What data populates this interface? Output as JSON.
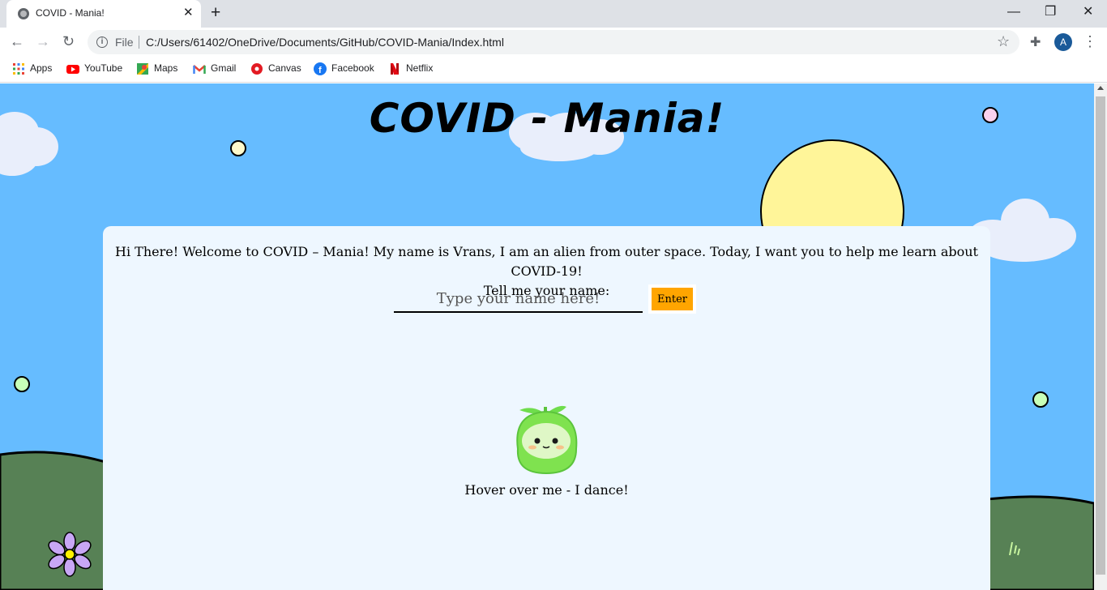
{
  "browser": {
    "tab_title": "COVID - Mania!",
    "tab_close": "✕",
    "new_tab": "+",
    "window_controls": {
      "minimize": "—",
      "restore": "❐",
      "close": "✕"
    },
    "nav": {
      "back": "←",
      "forward": "→",
      "reload": "↻"
    },
    "address": {
      "info": "i",
      "scheme_label": "File",
      "url": "C:/Users/61402/OneDrive/Documents/GitHub/COVID-Mania/Index.html"
    },
    "profile_initial": "A",
    "star": "☆",
    "extensions": "✚",
    "menu": "⋮",
    "bookmarks": [
      {
        "label": "Apps",
        "icon": "apps-grid-icon"
      },
      {
        "label": "YouTube",
        "icon": "youtube-icon"
      },
      {
        "label": "Maps",
        "icon": "maps-icon"
      },
      {
        "label": "Gmail",
        "icon": "gmail-icon"
      },
      {
        "label": "Canvas",
        "icon": "canvas-icon"
      },
      {
        "label": "Facebook",
        "icon": "facebook-icon"
      },
      {
        "label": "Netflix",
        "icon": "netflix-icon"
      }
    ]
  },
  "page": {
    "title": "COVID - Mania!",
    "welcome_line1": "Hi There! Welcome to COVID – Mania! My name is Vrans, I am an alien from outer space. Today, I want you to help me learn about COVID-19!",
    "welcome_line2": "Tell me your name:",
    "name_input": {
      "placeholder": "Type your name here!",
      "value": ""
    },
    "enter_label": "Enter",
    "hover_caption": "Hover over me - I dance!"
  },
  "colors": {
    "sky": "#66bcff",
    "grass": "#578155",
    "panel": "#eef7ff",
    "sun": "#fff599",
    "enter_button": "#ffa500"
  }
}
